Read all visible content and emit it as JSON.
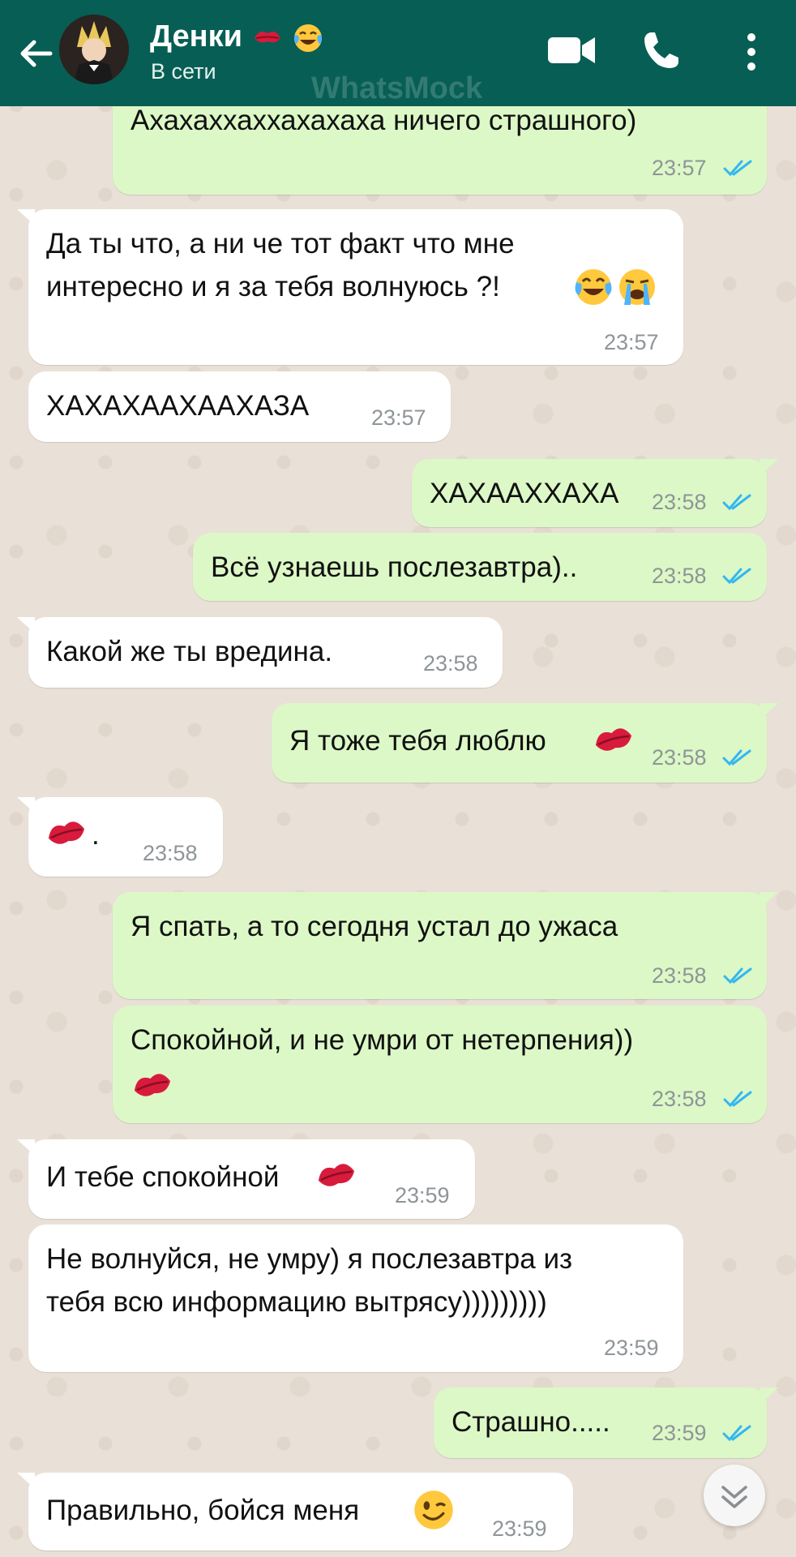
{
  "header": {
    "contact_name": "Денки",
    "status": "В сети",
    "watermark": "WhatsMock"
  },
  "messages": [
    {
      "dir": "out",
      "text": "Ахахаххаххахахаха ничего страшного)",
      "time": "23:57",
      "read": true
    },
    {
      "dir": "in",
      "text": "Да ты что, а ни че тот факт что мне\nинтересно и я за тебя волнуюсь ?!",
      "time": "23:57",
      "emoji": [
        "tears-of-joy",
        "loudly-crying"
      ]
    },
    {
      "dir": "in",
      "text": "ХАХАХААХААХАЗА",
      "time": "23:57"
    },
    {
      "dir": "out",
      "text": "ХАХААХХАХА",
      "time": "23:58",
      "read": true
    },
    {
      "dir": "out",
      "text": "Всё узнаешь послезавтра)..",
      "time": "23:58",
      "read": true
    },
    {
      "dir": "in",
      "text": "Какой же ты вредина.",
      "time": "23:58"
    },
    {
      "dir": "out",
      "text": "Я тоже тебя люблю",
      "time": "23:58",
      "read": true,
      "emoji": [
        "kiss-mark"
      ]
    },
    {
      "dir": "in",
      "text": ".",
      "time": "23:58",
      "emoji": [
        "kiss-mark"
      ]
    },
    {
      "dir": "out",
      "text": "Я спать, а то сегодня устал до ужаса",
      "time": "23:58",
      "read": true
    },
    {
      "dir": "out",
      "text": "Спокойной, и не умри от нетерпения))",
      "time": "23:58",
      "read": true,
      "emoji": [
        "kiss-mark"
      ]
    },
    {
      "dir": "in",
      "text": "И тебе спокойной",
      "time": "23:59",
      "emoji": [
        "kiss-mark"
      ]
    },
    {
      "dir": "in",
      "text": "Не волнуйся, не умру) я послезавтра из\nтебя всю информацию вытрясу)))))))))",
      "time": "23:59"
    },
    {
      "dir": "out",
      "text": "Страшно.....",
      "time": "23:59",
      "read": true
    },
    {
      "dir": "in",
      "text": "Правильно, бойся меня",
      "time": "23:59",
      "emoji": [
        "winking-face"
      ]
    }
  ],
  "colors": {
    "header": "#075e54",
    "outgoing": "#dcf8c6",
    "incoming": "#ffffff",
    "read_ticks": "#34b7f1"
  },
  "icons": {
    "back": "arrow-left-icon",
    "video": "video-camera-icon",
    "call": "phone-icon",
    "menu": "more-vertical-icon",
    "scroll": "chevron-down-icon"
  }
}
